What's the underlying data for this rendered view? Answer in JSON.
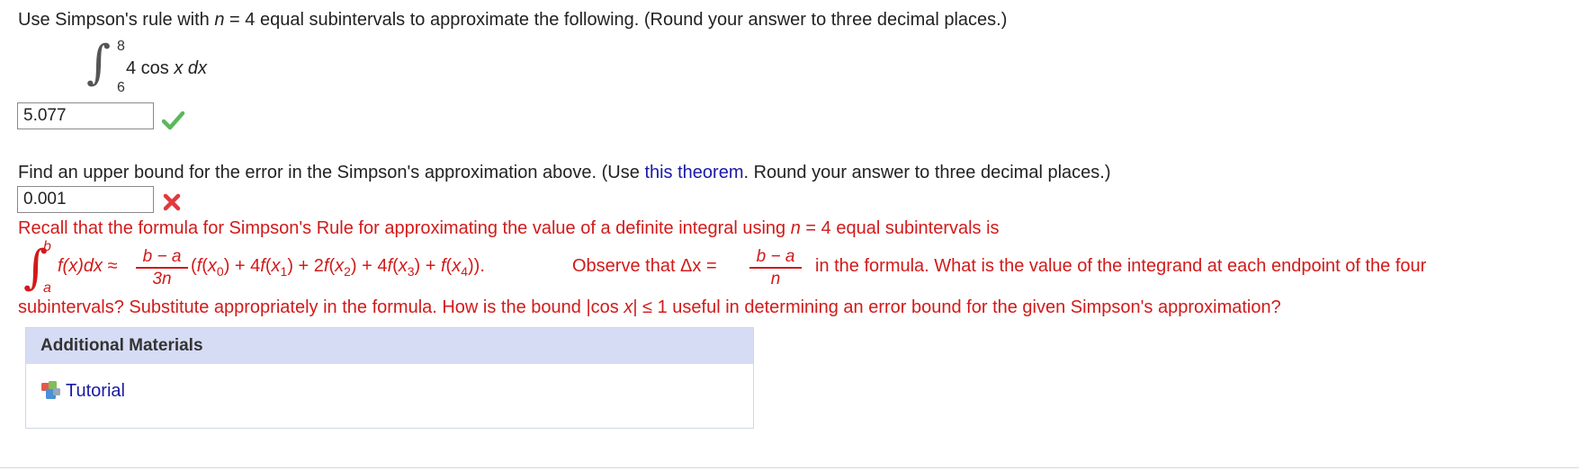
{
  "question1": {
    "prompt_a": "Use Simpson's rule with ",
    "n_var": "n",
    "n_eq": " = 4 ",
    "prompt_b": " equal subintervals to approximate the following. (Round your answer to three decimal places.)",
    "upper": "8",
    "lower": "6",
    "integrand": "4 cos ",
    "var_x": "x",
    "dx": "dx",
    "answer": "5.077",
    "status": "correct"
  },
  "question2": {
    "prompt_a": "Find an upper bound for the error in the Simpson's approximation above. (Use ",
    "link": "this theorem",
    "prompt_b": ". Round your answer to three decimal places.)",
    "answer": "0.001",
    "status": "incorrect"
  },
  "feedback": {
    "line1_a": "Recall that the formula for Simpson's Rule for approximating the value of a definite integral using ",
    "line1_n": "n",
    "line1_eq": " = 4 ",
    "line1_b": " equal subintervals is",
    "int_upper": "b",
    "int_lower": "a",
    "fx": "f(x)dx ≈",
    "frac1_num": "b − a",
    "frac1_den": "3n",
    "sum": "(f(x0) + 4f(x1) + 2f(x2) + 4f(x3) + f(x4)).",
    "observe": "Observe that  Δx =",
    "frac2_num": "b − a",
    "frac2_den": "n",
    "line2_tail": "in the formula. What is the value of the integrand at each endpoint of the four",
    "line3": "subintervals? Substitute appropriately in the formula. How is the bound  |cos x| ≤ 1  useful in determining an error bound for the given Simpson's approximation?"
  },
  "materials": {
    "heading": "Additional Materials",
    "tutorial": "Tutorial"
  },
  "colors": {
    "correct": "#5cb85c",
    "incorrect": "#e0393e",
    "feedback": "#d21a1a",
    "link": "#1a1aa6",
    "panel_header": "#d6dcf4"
  }
}
